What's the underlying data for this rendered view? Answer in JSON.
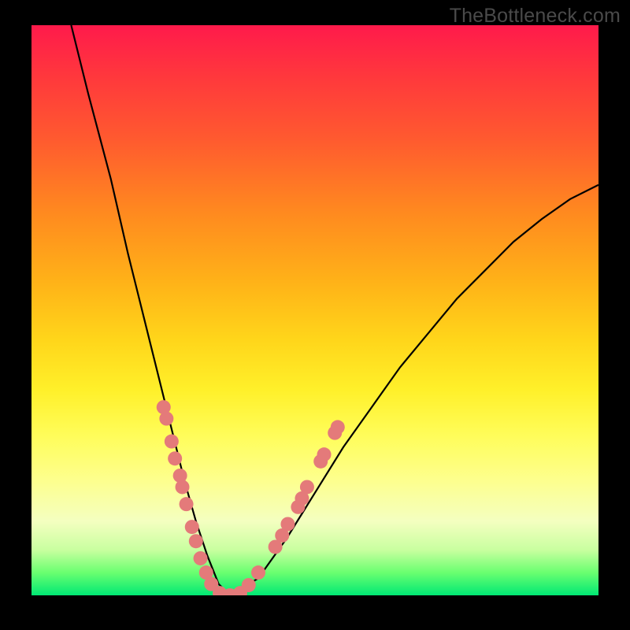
{
  "watermark": "TheBottleneck.com",
  "colors": {
    "background": "#000000",
    "curve": "#000000",
    "marker_fill": "#e47a7a",
    "marker_stroke": "#c85a5a"
  },
  "chart_data": {
    "type": "line",
    "title": "",
    "xlabel": "",
    "ylabel": "",
    "xlim": [
      0,
      100
    ],
    "ylim": [
      0,
      100
    ],
    "grid": false,
    "legend": false,
    "series": [
      {
        "name": "bottleneck-curve",
        "x": [
          7,
          10,
          14,
          17,
          19,
          21,
          23,
          25,
          27,
          29,
          31,
          33,
          35,
          40,
          45,
          50,
          55,
          60,
          65,
          70,
          75,
          80,
          85,
          90,
          95,
          100
        ],
        "y": [
          100,
          88,
          73,
          60,
          52,
          44,
          36,
          28,
          20,
          13,
          7,
          2,
          0,
          3,
          10,
          18,
          26,
          33,
          40,
          46,
          52,
          57,
          62,
          66,
          69.5,
          72
        ]
      }
    ],
    "markers": [
      {
        "x": 23.3,
        "y": 33.0
      },
      {
        "x": 23.8,
        "y": 31.0
      },
      {
        "x": 24.7,
        "y": 27.0
      },
      {
        "x": 25.3,
        "y": 24.0
      },
      {
        "x": 26.2,
        "y": 21.0
      },
      {
        "x": 26.6,
        "y": 19.0
      },
      {
        "x": 27.3,
        "y": 16.0
      },
      {
        "x": 28.3,
        "y": 12.0
      },
      {
        "x": 29.0,
        "y": 9.5
      },
      {
        "x": 29.8,
        "y": 6.5
      },
      {
        "x": 30.8,
        "y": 4.0
      },
      {
        "x": 31.7,
        "y": 2.0
      },
      {
        "x": 33.2,
        "y": 0.4
      },
      {
        "x": 35.0,
        "y": 0.0
      },
      {
        "x": 36.8,
        "y": 0.4
      },
      {
        "x": 38.3,
        "y": 1.8
      },
      {
        "x": 40.0,
        "y": 4.0
      },
      {
        "x": 43.0,
        "y": 8.5
      },
      {
        "x": 44.2,
        "y": 10.5
      },
      {
        "x": 45.2,
        "y": 12.5
      },
      {
        "x": 47.0,
        "y": 15.5
      },
      {
        "x": 47.7,
        "y": 17.0
      },
      {
        "x": 48.6,
        "y": 19.0
      },
      {
        "x": 51.0,
        "y": 23.5
      },
      {
        "x": 51.6,
        "y": 24.7
      },
      {
        "x": 53.5,
        "y": 28.5
      },
      {
        "x": 54.0,
        "y": 29.5
      }
    ]
  }
}
